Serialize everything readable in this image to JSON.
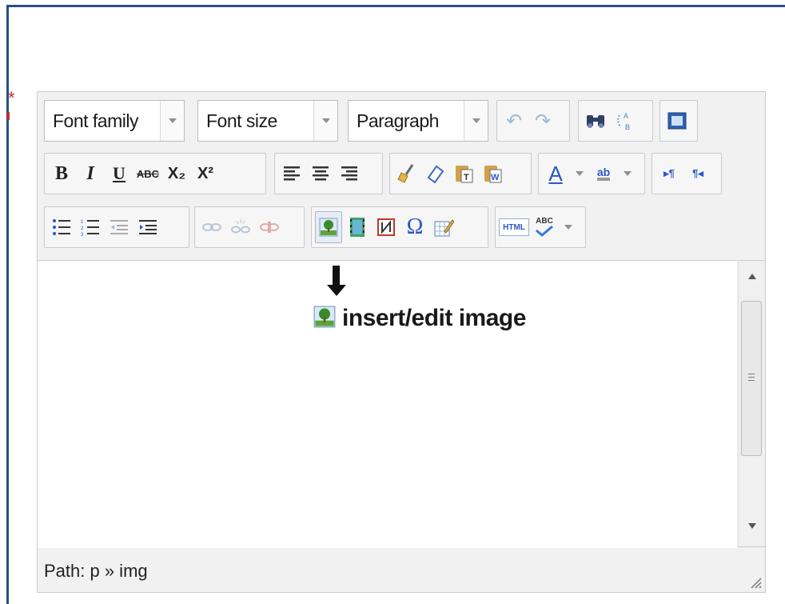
{
  "required_marker": "*",
  "toolbar": {
    "font_family": "Font family",
    "font_size": "Font size",
    "format": "Paragraph",
    "bold": "B",
    "italic": "I",
    "underline": "U",
    "strikethrough": "ABC",
    "subscript": "X₂",
    "superscript": "X²",
    "text_color": "A",
    "highlight": "ab",
    "html": "HTML",
    "spellcheck": "ABC",
    "special_char": "Ω",
    "ltr": "▸¶",
    "rtl": "¶◂"
  },
  "content": {
    "hint_label": "insert/edit image"
  },
  "status": {
    "path": "Path: p » img"
  },
  "colors": {
    "accent_frame": "#2b4f86",
    "required": "#d3262b",
    "text_color_bar": "#2a57c8",
    "highlight_bar": "#999999"
  }
}
